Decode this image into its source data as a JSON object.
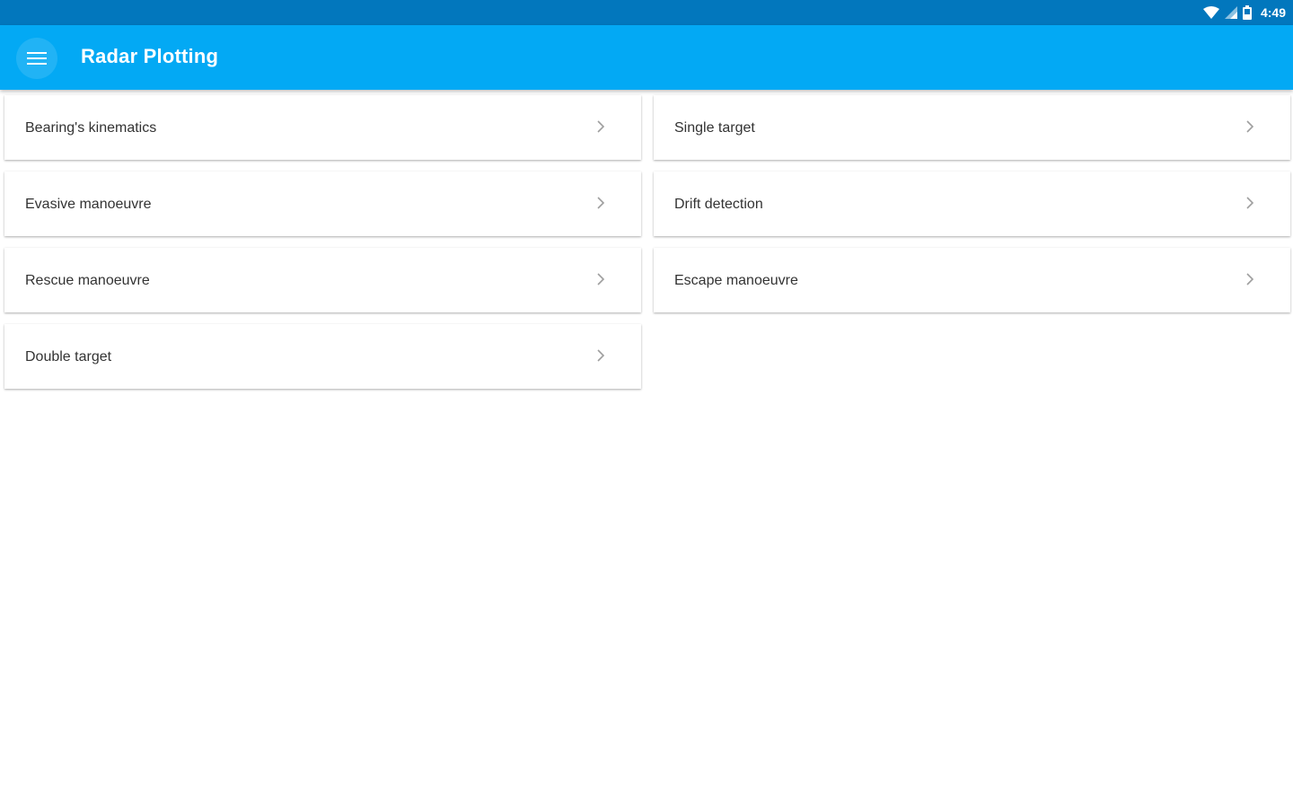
{
  "status_bar": {
    "time": "4:49",
    "icons": [
      "wifi-icon",
      "signal-icon",
      "battery-icon"
    ]
  },
  "app_bar": {
    "title": "Radar Plotting",
    "menu_icon": "hamburger-menu-icon"
  },
  "colors": {
    "status_bar": "#0277bd",
    "app_bar": "#03a9f4",
    "card_text": "#333333",
    "chevron": "#9e9e9e"
  },
  "menu": {
    "items": [
      {
        "label": "Bearing's kinematics",
        "icon": "chevron-right-icon"
      },
      {
        "label": "Single target",
        "icon": "chevron-right-icon"
      },
      {
        "label": "Evasive manoeuvre",
        "icon": "chevron-right-icon"
      },
      {
        "label": "Drift detection",
        "icon": "chevron-right-icon"
      },
      {
        "label": "Rescue manoeuvre",
        "icon": "chevron-right-icon"
      },
      {
        "label": "Escape manoeuvre",
        "icon": "chevron-right-icon"
      },
      {
        "label": "Double target",
        "icon": "chevron-right-icon"
      }
    ]
  }
}
